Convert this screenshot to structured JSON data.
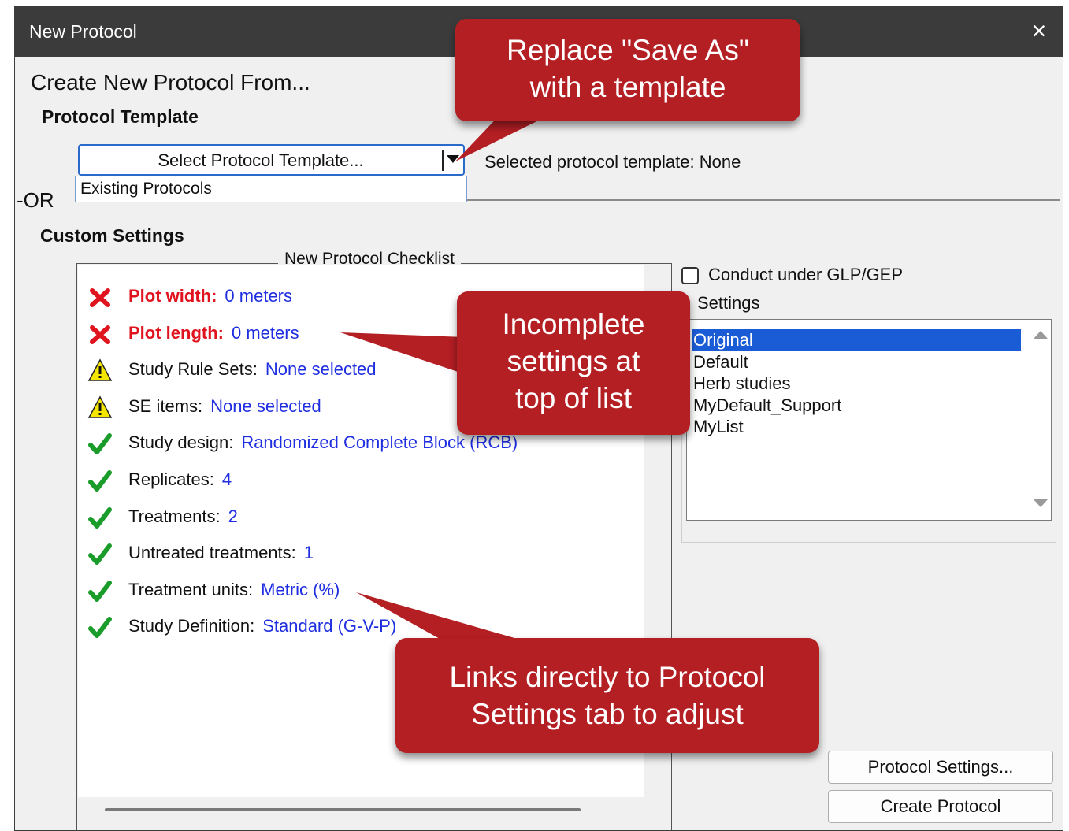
{
  "window": {
    "title": "New Protocol",
    "close_icon": "×"
  },
  "heading": "Create New Protocol From...",
  "template_section": {
    "title": "Protocol Template",
    "select_label": "Select Protocol Template...",
    "selected_text": "Selected protocol template: None",
    "dropdown_item": "Existing Protocols"
  },
  "or_label": "-OR",
  "custom_section": {
    "title": "Custom Settings",
    "checklist_title": "New Protocol Checklist",
    "items": [
      {
        "status": "error",
        "label": "Plot width:",
        "value": "0 meters"
      },
      {
        "status": "error",
        "label": "Plot length:",
        "value": "0 meters"
      },
      {
        "status": "warning",
        "label": "Study Rule Sets:",
        "value": "None selected"
      },
      {
        "status": "warning",
        "label": "SE items:",
        "value": "None selected"
      },
      {
        "status": "ok",
        "label": "Study design:",
        "value": "Randomized Complete Block (RCB)"
      },
      {
        "status": "ok",
        "label": "Replicates:",
        "value": "4"
      },
      {
        "status": "ok",
        "label": "Treatments:",
        "value": "2"
      },
      {
        "status": "ok",
        "label": "Untreated treatments:",
        "value": "1"
      },
      {
        "status": "ok",
        "label": "Treatment units:",
        "value": "Metric (%)"
      },
      {
        "status": "ok",
        "label": "Study Definition:",
        "value": "Standard (G-V-P)"
      }
    ]
  },
  "glp_checkbox": {
    "label": "Conduct under GLP/GEP",
    "checked": false
  },
  "settings": {
    "title": "Settings",
    "options": [
      "Original",
      "Default",
      "Herb studies",
      "MyDefault_Support",
      "MyList"
    ],
    "selected": "Original"
  },
  "buttons": {
    "protocol_settings": "Protocol Settings...",
    "create_protocol": "Create Protocol"
  },
  "callouts": {
    "save_as": [
      "Replace \"Save As\"",
      "with a template"
    ],
    "incomplete": [
      "Incomplete",
      "settings at",
      "top of list"
    ],
    "links": [
      "Links directly to Protocol",
      "Settings tab to adjust"
    ]
  },
  "colors": {
    "error": "#e0141e",
    "value": "#1e2ee0",
    "ok": "#1a9c2a",
    "warning": "#f5e600",
    "selection": "#1a5bd6",
    "callout": "#b41f24",
    "titlebar": "#3b3b3b"
  }
}
